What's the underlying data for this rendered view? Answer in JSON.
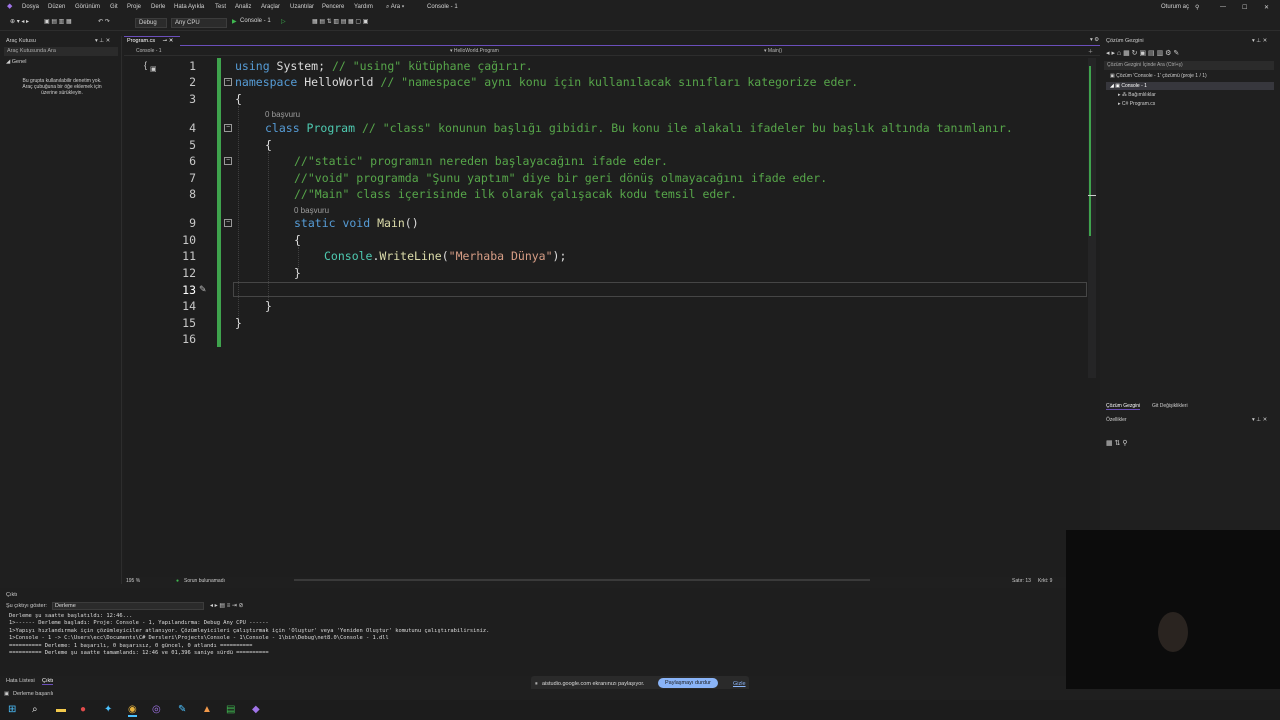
{
  "menu": [
    "Dosya",
    "Düzen",
    "Görünüm",
    "Git",
    "Proje",
    "Derle",
    "Hata Ayıkla",
    "Test",
    "Analiz",
    "Araçlar",
    "Uzantılar",
    "Pencere",
    "Yardım"
  ],
  "search_label": "Ara",
  "window_title": "Console - 1",
  "user_label": "Oturum aç",
  "toolbar": {
    "config": "Debug",
    "platform": "Any CPU",
    "run_label": "Console - 1"
  },
  "toolbox": {
    "title": "Araç Kutusu",
    "search": "Araç Kutusunda Ara",
    "group": "Genel",
    "empty_line1": "Bu grupta kullanılabilir denetim yok.",
    "empty_line2": "Araç çubuğuna bir öğe eklemek için",
    "empty_line3": "üzerine sürükleyin."
  },
  "editor": {
    "tab_label": "Program.cs",
    "project_combo": "Console - 1",
    "class_combo": "HelloWorld.Program",
    "member_combo": "Main()",
    "ref_label": "0 başvuru",
    "line_numbers": [
      "1",
      "2",
      "3",
      "4",
      "5",
      "6",
      "7",
      "8",
      "9",
      "10",
      "11",
      "12",
      "13",
      "14",
      "15",
      "16"
    ],
    "l1_kw": "using",
    "l1_id": " System;",
    "l1_cm": " // \"using\" kütüphane çağırır.",
    "l2_kw": "namespace",
    "l2_id": " HelloWorld",
    "l2_cm": " // \"namespace\" aynı konu için kullanılacak sınıfları kategorize eder.",
    "l3": "{",
    "l4_kw": "class",
    "l4_cls": " Program",
    "l4_cm": " // \"class\" konunun başlığı gibidir. Bu konu ile alakalı ifadeler bu başlık altında tanımlanır.",
    "l5": "{",
    "l6_cm": "//\"static\" programın nereden başlayacağını ifade eder.",
    "l7_cm": "//\"void\" programda \"Şunu yaptım\" diye bir geri dönüş olmayacağını ifade eder.",
    "l8_cm": "//\"Main\" class içerisinde ilk olarak çalışacak kodu temsil eder.",
    "l9_kw": "static void",
    "l9_mt": " Main",
    "l9_pl": "()",
    "l10": "{",
    "l11_cls": "Console",
    "l11_dot": ".",
    "l11_mt": "WriteLine",
    "l11_p1": "(",
    "l11_str": "\"Merhaba Dünya\"",
    "l11_p2": ");",
    "l12": "}",
    "l14": "}",
    "l15": "}"
  },
  "editor_status": {
    "zoom": "195 %",
    "issues": "Sorun bulunamadı",
    "line": "Satır: 13",
    "col": "Krkt: 9"
  },
  "solution": {
    "title": "Çözüm Gezgini",
    "search": "Çözüm Gezgini İçinde Ara (Ctrl+ş)",
    "root": "Çözüm 'Console - 1' çözümü (proje 1 / 1)",
    "project": "Console - 1",
    "deps": "Bağımlılıklar",
    "file": "Program.cs",
    "tab1": "Çözüm Gezgini",
    "tab2": "Git Değişiklikleri",
    "props": "Özellikler"
  },
  "output": {
    "title": "Çıktı",
    "show_label": "Şu çıktıyı göster:",
    "source": "Derleme",
    "lines": [
      "Derleme şu saatte başlatıldı: 12:46...",
      "1>------ Derleme başladı: Proje: Console - 1, Yapılandırma: Debug Any CPU ------",
      "1>Yapıyı hızlandırmak için çözümleyiciler atlanıyor. Çözümleyicileri çalıştırmak için 'Oluştur' veya 'Yeniden Oluştur' komutunu çalıştırabilirsiniz.",
      "1>Console - 1 -> C:\\Users\\ecc\\Documents\\C# Dersleri\\Projects\\Console - 1\\Console - 1\\bin\\Debug\\net8.0\\Console - 1.dll",
      "========== Derleme: 1 başarılı, 0 başarısız, 0 güncel, 0 atlandı ==========",
      "========== Derleme şu saatte tamamlandı: 12:46 ve 01,396 saniye sürdü =========="
    ],
    "tab1": "Hata Listesi",
    "tab2": "Çıktı"
  },
  "statusbar": {
    "text": "Derleme başarılı"
  },
  "share": {
    "text": "aistudio.google.com ekranınızı paylaşıyor.",
    "stop": "Paylaşmayı durdur",
    "hide": "Gizle"
  },
  "colors": {
    "accent": "#6b4fbb",
    "green_bar": "#3fa34d"
  }
}
